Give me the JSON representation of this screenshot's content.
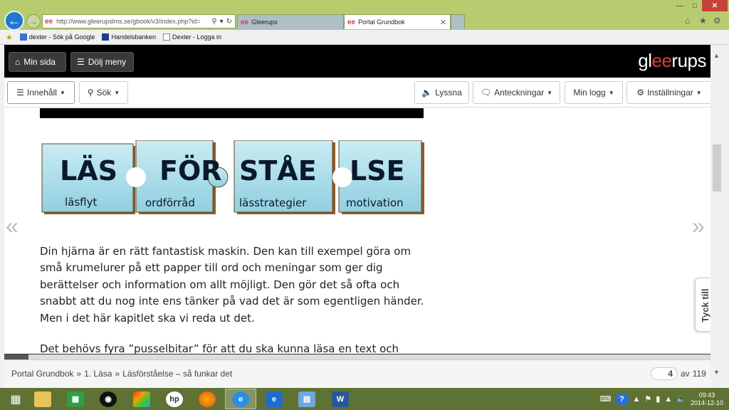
{
  "browser": {
    "address_url": "http://www.gleerupslms.se/gbook/v3/index.php?id=",
    "address_prefix": "ee",
    "tabs": [
      {
        "label": "Gleerups",
        "active": false
      },
      {
        "label": "Portal Grundbok",
        "active": true
      }
    ],
    "favorites": [
      {
        "label": "dexter - Sök på Google"
      },
      {
        "label": "Handelsbanken"
      },
      {
        "label": "Dexter - Logga in"
      }
    ]
  },
  "topbar": {
    "min_sida": "Min sida",
    "dolj_meny": "Dölj meny",
    "logo_pre": "gl",
    "logo_ee": "ee",
    "logo_post": "rups"
  },
  "toolbar": {
    "innehall": "Innehåll",
    "sok": "Sök",
    "lyssna": "Lyssna",
    "anteckningar": "Anteckningar",
    "min_logg": "Min logg",
    "installningar": "Inställningar"
  },
  "puzzle": {
    "title": "LÄSFÖRSTÅELSE",
    "pieces": [
      {
        "big": "LÄS",
        "small": "läsflyt"
      },
      {
        "big": "FÖR",
        "small": "ordförråd"
      },
      {
        "big": "STÅE",
        "small": "lässtrategier"
      },
      {
        "big": "LSE",
        "small": "motivation"
      }
    ]
  },
  "content": {
    "paragraph1": "Din hjärna är en rätt fantastisk maskin. Den kan till exempel göra om små krumelurer på ett papper till ord och meningar som ger dig berättelser och information om allt möjligt. Den gör det så ofta och snabbt att du nog inte ens tänker på vad det är som egentligen händer. Men i det här kapitlet ska vi reda ut det.",
    "paragraph2": "Det behövs fyra ”pusselbitar” för att du ska kunna läsa en text och"
  },
  "feedback": {
    "label": "Tyck till"
  },
  "footer": {
    "breadcrumb": [
      "Portal Grundbok",
      "»",
      "1. Läsa",
      "»",
      "Läsförståelse – så funkar det"
    ],
    "page_current": "4",
    "page_of": "av",
    "page_total": "119",
    "progress_fraction": 0.034
  },
  "taskbar": {
    "apps": [
      "start",
      "file-explorer",
      "store",
      "media-center",
      "photo-app",
      "hp",
      "firefox",
      "internet-explorer-active",
      "internet-explorer",
      "remote-desktop",
      "word"
    ],
    "clock_time": "09:43",
    "clock_date": "2014-12-10"
  },
  "colors": {
    "logo_accent": "#e03a3a",
    "window_frame": "#b6cc6e",
    "taskbar": "#5e7233",
    "puzzle_piece": "#a8dce8",
    "puzzle_edge": "#8b5a2b"
  }
}
